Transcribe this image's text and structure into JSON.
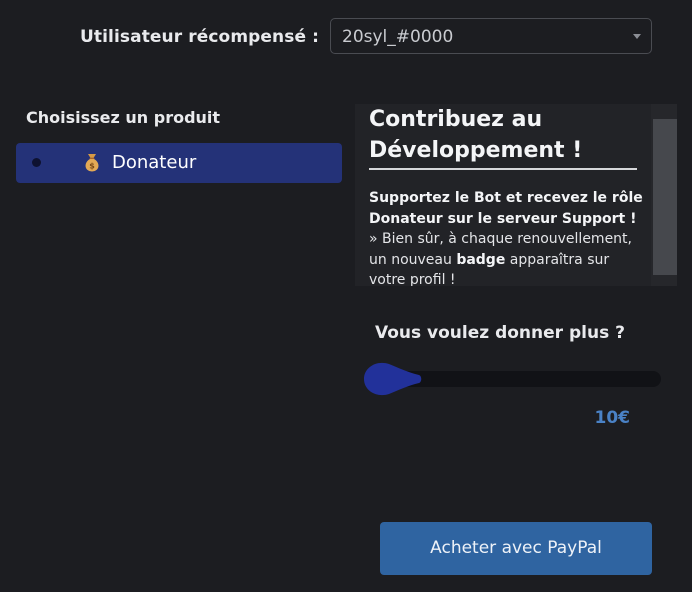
{
  "user_selector": {
    "label": "Utilisateur récompensé :",
    "selected_value": "20syl_#0000",
    "caret_icon": "caret-down-icon"
  },
  "products": {
    "heading": "Choisissez un produit",
    "items": [
      {
        "label": "Donateur",
        "icon": "money-bag-icon",
        "selected": true
      }
    ]
  },
  "description": {
    "title": "Contribuez au Développement !",
    "bold_intro": "Supportez le Bot et recevez le rôle Donateur sur le serveur Support !",
    "text_before_badge": "» Bien sûr, à chaque renouvellement, un nouveau ",
    "badge_word": "badge",
    "text_after_badge": " apparaîtra sur votre profil !"
  },
  "donation": {
    "label": "Vous voulez donner plus ?",
    "amount": "10€",
    "slider_level": 0
  },
  "buy_button": {
    "label": "Acheter avec PayPal"
  },
  "colors": {
    "background": "#1c1d21",
    "selected_item": "#243278",
    "accent_amount": "#4a82c6",
    "button": "#2f64a1"
  }
}
